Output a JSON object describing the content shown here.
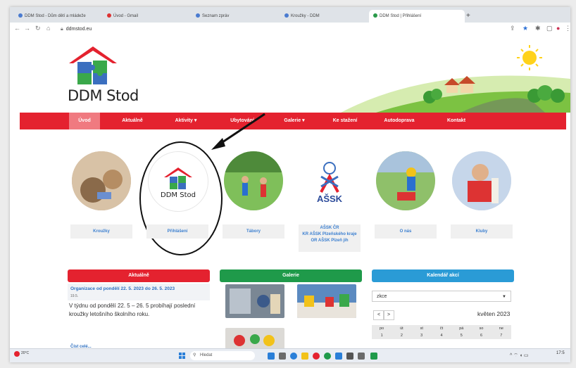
{
  "browser": {
    "tabs": [
      {
        "label": "DDM Stod - Dům dětí a mládeže"
      },
      {
        "label": "Úvod - Gmail"
      },
      {
        "label": "Seznam zpráv"
      },
      {
        "label": "Kroužky - DDM"
      },
      {
        "label": "DDM Stod | Přihlášení"
      }
    ],
    "url": "ddmstod.eu"
  },
  "site": {
    "logo_text": "DDM Stod",
    "menu": [
      {
        "label": "Úvod"
      },
      {
        "label": "Aktuálně"
      },
      {
        "label": "Aktivity ▾"
      },
      {
        "label": "Ubytování"
      },
      {
        "label": "Galerie ▾"
      },
      {
        "label": "Ke stažení"
      },
      {
        "label": "Autodoprava"
      },
      {
        "label": "Kontakt"
      }
    ],
    "circles": [
      {
        "label": "Kroužky"
      },
      {
        "label": "Přihlášení",
        "logo_text": "DDM Stod"
      },
      {
        "label": "Tábory"
      },
      {
        "label_lines": [
          "AŠSK ČR",
          "KR AŠSK Plzeňského kraje",
          "OR AŠSK Plzeň jih"
        ],
        "logo_text": "AŠSK"
      },
      {
        "label": "O nás"
      },
      {
        "label": "Kluby"
      }
    ],
    "sections": {
      "news": {
        "heading": "Aktuálně",
        "color": "#e4222f"
      },
      "gallery": {
        "heading": "Galerie",
        "color": "#1f9a4a"
      },
      "calendar": {
        "heading": "Kalendář akcí",
        "color": "#2a9bd6"
      }
    },
    "news_item": {
      "title": "Organizace od pondělí 22. 5. 2023 do 26. 5. 2023",
      "date": "19.5.",
      "body": "V týdnu od pondělí 22. 5 – 26. 5 probíhají poslední kroužky letošního školního roku.",
      "read_more": "Číst celé..."
    },
    "calendar": {
      "select_value": "zkce",
      "prev": "<",
      "next": ">",
      "month": "květen 2023",
      "weekdays": [
        "po",
        "út",
        "st",
        "čt",
        "pá",
        "so",
        "ne"
      ],
      "week1": [
        "1",
        "2",
        "3",
        "4",
        "5",
        "6",
        "7"
      ]
    }
  },
  "taskbar": {
    "weather": "20°C",
    "search_placeholder": "Hledat",
    "time": "17:5"
  }
}
